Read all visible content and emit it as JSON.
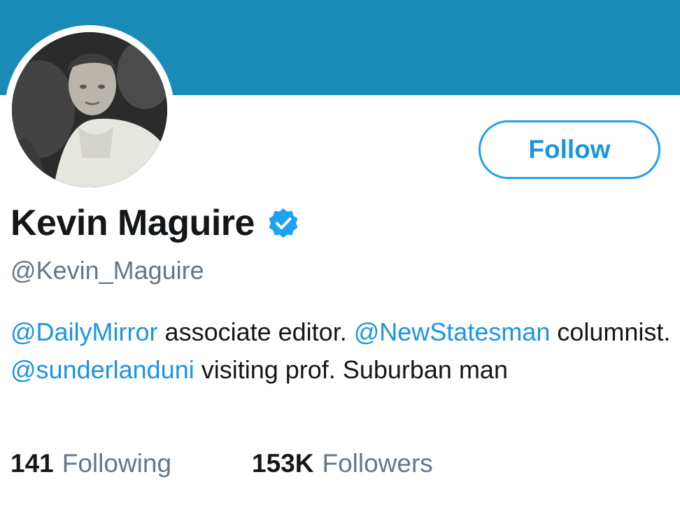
{
  "profile": {
    "display_name": "Kevin Maguire",
    "handle": "@Kevin_Maguire",
    "verified_icon": "verified-badge-icon",
    "follow_label": "Follow",
    "bio": {
      "mention_1": "@DailyMirror",
      "text_1": " associate editor. ",
      "mention_2": "@NewStatesman",
      "text_2": " columnist. ",
      "mention_3": "@sunderlanduni",
      "text_3": " visiting prof. Suburban man"
    },
    "stats": {
      "following_count": "141",
      "following_label": "Following",
      "followers_count": "153K",
      "followers_label": "Followers"
    }
  },
  "colors": {
    "banner": "#1a8ab6",
    "accent": "#1da1f2",
    "link": "#1b95e0",
    "text": "#14171a",
    "secondary_text": "#657786"
  }
}
